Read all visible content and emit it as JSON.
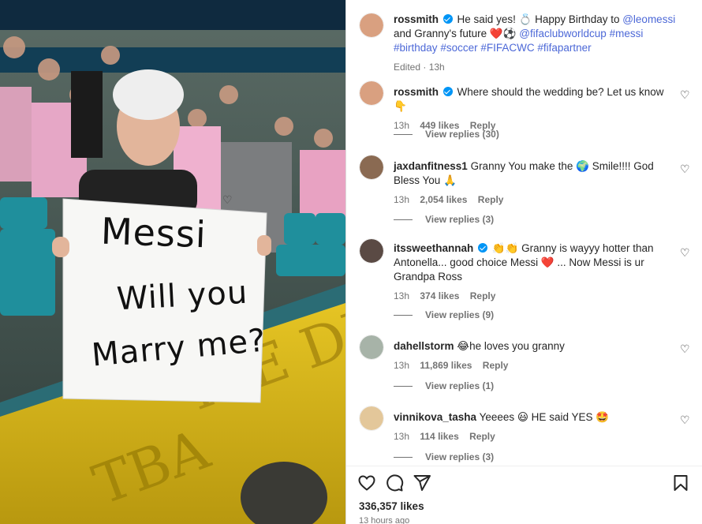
{
  "photo": {
    "sign_lines": [
      "Messi",
      "Will you",
      "Marry me?"
    ]
  },
  "caption": {
    "username": "rossmith",
    "parts": [
      "He said yes! ",
      "💍",
      " Happy Birthday to ",
      "@leomessi",
      " and Granny's future ",
      "❤️⚽",
      " ",
      "@fifaclubworldcup",
      " ",
      "#messi",
      " ",
      "#birthday",
      " ",
      "#soccer",
      " ",
      "#FIFACWC",
      " ",
      "#fifapartner"
    ],
    "edited": "Edited · 13h"
  },
  "comments": [
    {
      "username": "rossmith",
      "verified": true,
      "text": "Where should the wedding be? Let us know 👇",
      "time": "13h",
      "likes": "449 likes",
      "reply": "Reply",
      "view_replies": "View replies (30)"
    },
    {
      "username": "jaxdanfitness1",
      "verified": false,
      "text": "Granny You make the 🌍 Smile!!!! God Bless You 🙏",
      "time": "13h",
      "likes": "2,054 likes",
      "reply": "Reply",
      "view_replies": "View replies (3)"
    },
    {
      "username": "itssweethannah",
      "verified": true,
      "text": "👏👏 Granny is wayyy hotter than Antonella... good choice Messi ❤️ ... Now Messi is ur Grandpa Ross",
      "time": "13h",
      "likes": "374 likes",
      "reply": "Reply",
      "view_replies": "View replies (9)"
    },
    {
      "username": "dahellstorm",
      "verified": false,
      "text": "😂he loves you granny",
      "time": "13h",
      "likes": "11,869 likes",
      "reply": "Reply",
      "view_replies": "View replies (1)"
    },
    {
      "username": "vinnikova_tasha",
      "verified": false,
      "text": "Yeeees 😃 HE said YES 🤩",
      "time": "13h",
      "likes": "114 likes",
      "reply": "Reply",
      "view_replies": "View replies (3)"
    }
  ],
  "actions": {
    "likes": "336,357 likes",
    "time_ago": "13 hours ago"
  },
  "colors": {
    "link": "#4c68d7",
    "verified": "#0095f6",
    "muted": "#737373"
  }
}
